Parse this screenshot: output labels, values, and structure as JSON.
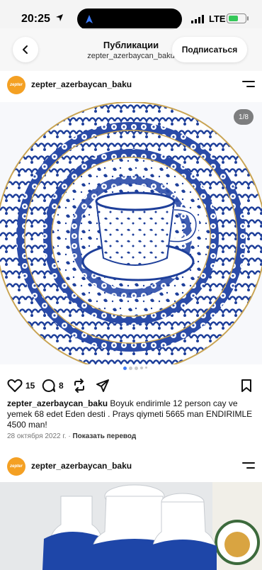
{
  "status_bar": {
    "time": "20:25",
    "network": "LTE"
  },
  "header": {
    "title": "Публикации",
    "subtitle": "zepter_azerbaycan_baku",
    "subscribe_label": "Подписаться"
  },
  "posts": [
    {
      "username": "zepter_azerbaycan_baku",
      "avatar_text": "zepter",
      "image_counter": "1/8",
      "likes": "15",
      "comments": "8",
      "caption_user": "zepter_azerbaycan_baku",
      "caption_text": " Boyuk endirimle 12 person cay ve yemek 68 edet Eden desti . Prays qiymeti 5665  man ENDIRIMLE 4500 man!",
      "date": "28 октября 2022 г.",
      "translate_label": "Показать перевод"
    },
    {
      "username": "zepter_azerbaycan_baku",
      "avatar_text": "zepter"
    }
  ],
  "colors": {
    "accent_blue": "#1e3f9a",
    "avatar_orange": "#f4a023"
  },
  "icons": [
    "location-arrow-icon",
    "back-chevron-icon",
    "more-menu-icon",
    "heart-icon",
    "comment-icon",
    "repost-icon",
    "share-icon",
    "bookmark-icon"
  ]
}
